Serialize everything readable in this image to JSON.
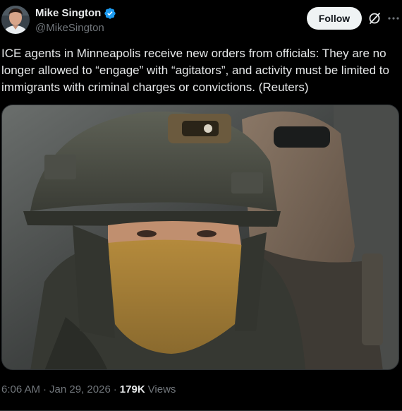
{
  "author": {
    "display_name": "Mike Sington",
    "handle": "@MikeSington",
    "verified": true,
    "verified_color": "#1d9bf0"
  },
  "actions": {
    "follow_label": "Follow",
    "grok_icon": "grok-icon",
    "more_icon": "more-icon"
  },
  "post": {
    "text": "ICE agents in Minneapolis receive new orders from officials: They are no longer allowed to “engage” with “agitators”, and activity must be limited to immigrants with criminal charges or convictions. (Reuters)",
    "time": "6:06 AM",
    "date": "Jan 29, 2026",
    "views_count": "179K",
    "views_label": "Views",
    "separator": "·"
  },
  "colors": {
    "background": "#000000",
    "text_primary": "#e7e9ea",
    "text_secondary": "#71767b",
    "follow_bg": "#eff3f4"
  }
}
